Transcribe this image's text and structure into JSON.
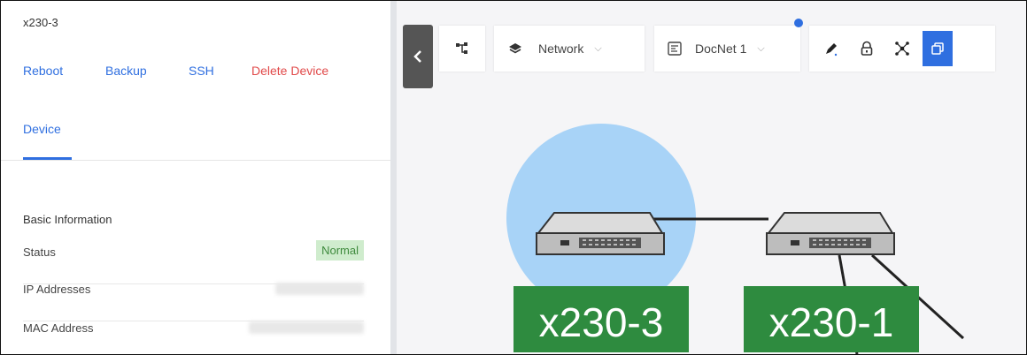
{
  "device": {
    "name": "x230-3",
    "actions": {
      "reboot": "Reboot",
      "backup": "Backup",
      "ssh": "SSH",
      "delete": "Delete Device"
    },
    "tabs": {
      "device": "Device"
    },
    "basic_info": {
      "title": "Basic Information",
      "status_label": "Status",
      "status_value": "Normal",
      "ip_label": "IP Addresses",
      "mac_label": "MAC Address"
    }
  },
  "toolbar": {
    "layer_label": "Network",
    "docnet_label": "DocNet 1"
  },
  "nodes": {
    "node1": "x230-3",
    "node2": "x230-1"
  },
  "colors": {
    "accent": "#2f6fe0",
    "danger": "#e14a4a",
    "status_bg": "#cfeccd",
    "status_fg": "#3f8a3d",
    "node_label_bg": "#2e8b3f",
    "selection_halo": "#a8d3f7"
  },
  "icons": {
    "collapse": "chevron-left-icon",
    "topology": "topology-icon",
    "layers": "layers-icon",
    "docnet": "document-icon",
    "edit": "pencil-icon",
    "lock": "lock-icon",
    "nodes": "nodes-icon",
    "copy": "copy-icon"
  }
}
